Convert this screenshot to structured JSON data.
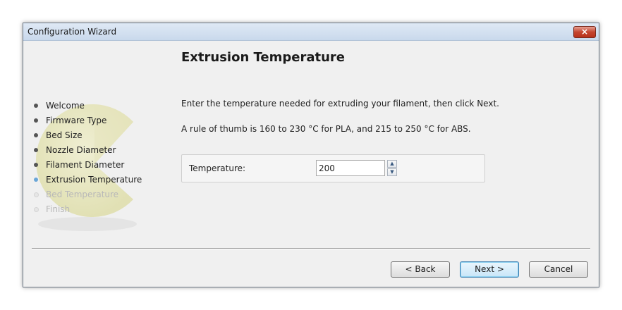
{
  "window": {
    "title": "Configuration Wizard",
    "close_glyph": "×"
  },
  "page": {
    "title": "Extrusion Temperature",
    "instruction": "Enter the temperature needed for extruding your filament, then click Next.",
    "rule": "A rule of thumb is 160 to 230 °C for PLA, and 215 to 250 °C for ABS."
  },
  "steps": [
    {
      "label": "Welcome",
      "state": "done"
    },
    {
      "label": "Firmware Type",
      "state": "done"
    },
    {
      "label": "Bed Size",
      "state": "done"
    },
    {
      "label": "Nozzle Diameter",
      "state": "done"
    },
    {
      "label": "Filament Diameter",
      "state": "done"
    },
    {
      "label": "Extrusion Temperature",
      "state": "current"
    },
    {
      "label": "Bed Temperature",
      "state": "pending"
    },
    {
      "label": "Finish",
      "state": "pending"
    }
  ],
  "temperature": {
    "label": "Temperature:",
    "value": "200",
    "up_glyph": "▲",
    "down_glyph": "▼"
  },
  "buttons": {
    "back": "< Back",
    "next": "Next >",
    "cancel": "Cancel"
  },
  "icons": {
    "logo": "slic3r-logo-icon",
    "close": "close-icon"
  },
  "colors": {
    "accent": "#6aa6d8",
    "close": "#c4452f"
  }
}
